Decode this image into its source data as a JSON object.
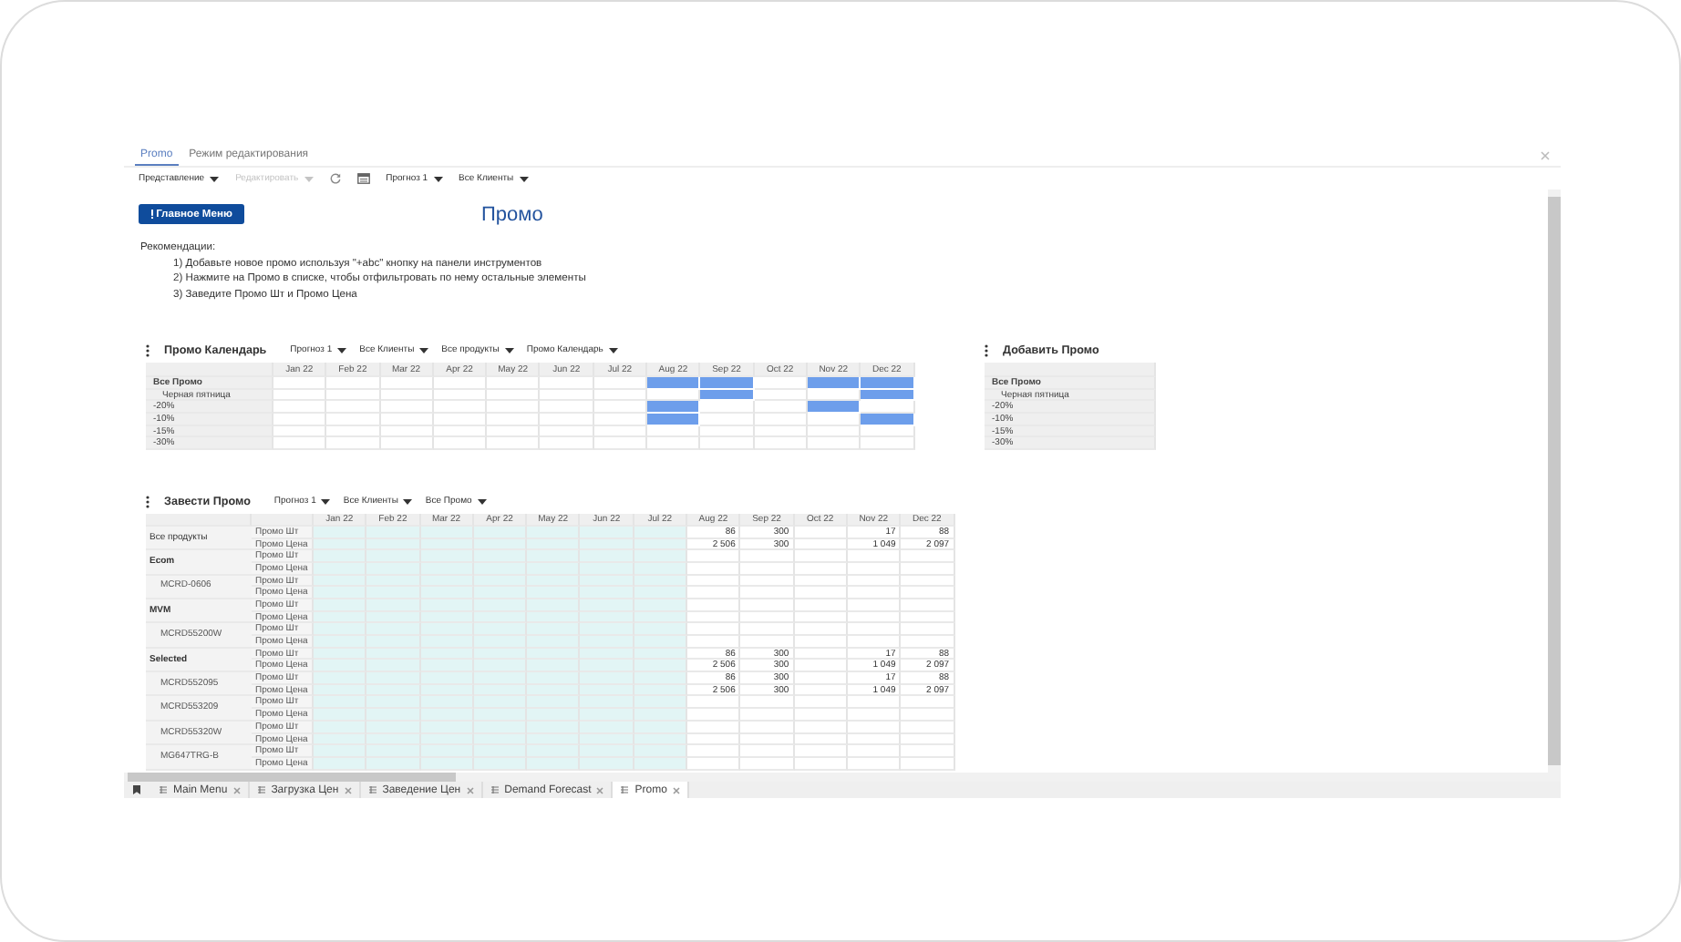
{
  "tabs": [
    {
      "label": "Promo",
      "selected": true
    },
    {
      "label": "Режим редактирования",
      "selected": false
    }
  ],
  "toolbar": {
    "menus": [
      {
        "label": "Представление",
        "disabled": false
      },
      {
        "label": "Редактировать",
        "disabled": true
      }
    ],
    "filters": [
      "Прогноз 1",
      "Все Клиенты"
    ]
  },
  "header": {
    "button": "Главное Меню",
    "title": "Промо"
  },
  "recommendations": {
    "title": "Рекомендации:",
    "items": [
      "1) Добавьте новое промо используя \"+abc\" кнопку на панели инструментов",
      "2) Нажмите на Промо в списке, чтобы отфильтровать по нему остальные элементы",
      "3) Заведите Промо Шт и Промо Цена"
    ]
  },
  "calendar": {
    "title": "Промо Календарь",
    "filters": [
      "Прогноз 1",
      "Все Клиенты",
      "Все продукты",
      "Промо Календарь"
    ],
    "columns": [
      "Jan 22",
      "Feb 22",
      "Mar 22",
      "Apr 22",
      "May 22",
      "Jun 22",
      "Jul 22",
      "Aug 22",
      "Sep 22",
      "Oct 22",
      "Nov 22",
      "Dec 22"
    ],
    "rows": [
      {
        "label": "Все Промо",
        "kind": "total",
        "filled": [
          false,
          false,
          false,
          false,
          false,
          false,
          false,
          true,
          true,
          false,
          true,
          true
        ]
      },
      {
        "label": "Черная пятница",
        "kind": "event",
        "filled": [
          false,
          false,
          false,
          false,
          false,
          false,
          false,
          false,
          true,
          false,
          false,
          true
        ]
      },
      {
        "label": "-20%",
        "kind": "discount",
        "filled": [
          false,
          false,
          false,
          false,
          false,
          false,
          false,
          true,
          false,
          false,
          true,
          false
        ]
      },
      {
        "label": "-10%",
        "kind": "discount",
        "filled": [
          false,
          false,
          false,
          false,
          false,
          false,
          false,
          true,
          false,
          false,
          false,
          true
        ]
      },
      {
        "label": "-15%",
        "kind": "discount",
        "filled": [
          false,
          false,
          false,
          false,
          false,
          false,
          false,
          false,
          false,
          false,
          false,
          false
        ]
      },
      {
        "label": "-30%",
        "kind": "discount",
        "filled": [
          false,
          false,
          false,
          false,
          false,
          false,
          false,
          false,
          false,
          false,
          false,
          false
        ]
      }
    ]
  },
  "add_promo": {
    "title": "Добавить Промо",
    "rows": [
      {
        "label": "Все Промо",
        "kind": "total"
      },
      {
        "label": "Черная пятница",
        "kind": "event"
      },
      {
        "label": "-20%",
        "kind": "discount"
      },
      {
        "label": "-10%",
        "kind": "discount"
      },
      {
        "label": "-15%",
        "kind": "discount"
      },
      {
        "label": "-30%",
        "kind": "discount"
      }
    ]
  },
  "enter_promo": {
    "title": "Завести Промо",
    "filters": [
      "Прогноз 1",
      "Все Клиенты",
      "Все Промо"
    ],
    "columns": [
      {
        "label": "Jan 22",
        "shaded": true
      },
      {
        "label": "Feb 22",
        "shaded": true
      },
      {
        "label": "Mar 22",
        "shaded": true
      },
      {
        "label": "Apr 22",
        "shaded": true
      },
      {
        "label": "May 22",
        "shaded": true
      },
      {
        "label": "Jun 22",
        "shaded": true
      },
      {
        "label": "Jul 22",
        "shaded": true
      },
      {
        "label": "Aug 22",
        "shaded": false
      },
      {
        "label": "Sep 22",
        "shaded": false
      },
      {
        "label": "Oct 22",
        "shaded": false
      },
      {
        "label": "Nov 22",
        "shaded": false
      },
      {
        "label": "Dec 22",
        "shaded": false
      }
    ],
    "rows": [
      {
        "label": "Все продукты",
        "kind": "total",
        "metrics": [
          {
            "label": "Промо Шт",
            "cells": [
              {},
              {},
              {},
              {},
              {},
              {},
              {},
              {
                "value": "86"
              },
              {
                "value": "300"
              },
              {},
              {
                "value": "17"
              },
              {
                "value": "88"
              }
            ]
          },
          {
            "label": "Промо Цена",
            "cells": [
              {},
              {},
              {},
              {},
              {},
              {},
              {},
              {
                "value": "2 506"
              },
              {
                "value": "300"
              },
              {},
              {
                "value": "1 049"
              },
              {
                "value": "2 097"
              }
            ]
          }
        ]
      },
      {
        "label": "Ecom",
        "kind": "group",
        "metrics": [
          {
            "label": "Промо Шт"
          },
          {
            "label": "Промо Цена"
          }
        ]
      },
      {
        "label": "MCRD-0606",
        "kind": "item",
        "metrics": [
          {
            "label": "Промо Шт"
          },
          {
            "label": "Промо Цена"
          }
        ]
      },
      {
        "label": "MVM",
        "kind": "group",
        "metrics": [
          {
            "label": "Промо Шт"
          },
          {
            "label": "Промо Цена"
          }
        ]
      },
      {
        "label": "MCRD55200W",
        "kind": "item",
        "metrics": [
          {
            "label": "Промо Шт"
          },
          {
            "label": "Промо Цена"
          }
        ]
      },
      {
        "label": "Selected",
        "kind": "group",
        "metrics": [
          {
            "label": "Промо Шт",
            "cells": [
              {},
              {},
              {},
              {},
              {},
              {},
              {},
              {
                "value": "86"
              },
              {
                "value": "300"
              },
              {},
              {
                "value": "17"
              },
              {
                "value": "88"
              }
            ]
          },
          {
            "label": "Промо Цена",
            "cells": [
              {},
              {},
              {},
              {},
              {},
              {},
              {},
              {
                "value": "2 506"
              },
              {
                "value": "300"
              },
              {},
              {
                "value": "1 049"
              },
              {
                "value": "2 097"
              }
            ]
          }
        ]
      },
      {
        "label": "MCRD552095",
        "kind": "item",
        "metrics": [
          {
            "label": "Промо Шт",
            "cells": [
              {},
              {},
              {},
              {},
              {},
              {},
              {},
              {
                "value": "86"
              },
              {
                "value": "300"
              },
              {},
              {
                "value": "17"
              },
              {
                "value": "88"
              }
            ]
          },
          {
            "label": "Промо Цена",
            "cells": [
              {},
              {},
              {},
              {},
              {},
              {},
              {},
              {
                "value": "2 506"
              },
              {
                "value": "300"
              },
              {},
              {
                "value": "1 049"
              },
              {
                "value": "2 097"
              }
            ]
          }
        ]
      },
      {
        "label": "MCRD553209",
        "kind": "item",
        "metrics": [
          {
            "label": "Промо Шт"
          },
          {
            "label": "Промо Цена"
          }
        ]
      },
      {
        "label": "MCRD55320W",
        "kind": "item",
        "metrics": [
          {
            "label": "Промо Шт"
          },
          {
            "label": "Промо Цена"
          }
        ]
      },
      {
        "label": "MG647TRG-B",
        "kind": "item",
        "metrics": [
          {
            "label": "Промо Шт"
          },
          {
            "label": "Промо Цена"
          }
        ]
      }
    ]
  },
  "bottom_tabs": [
    {
      "label": "Main Menu",
      "selected": false
    },
    {
      "label": "Загрузка Цен",
      "selected": false
    },
    {
      "label": "Заведение Цен",
      "selected": false
    },
    {
      "label": "Demand Forecast",
      "selected": false
    },
    {
      "label": "Promo",
      "selected": true
    }
  ]
}
